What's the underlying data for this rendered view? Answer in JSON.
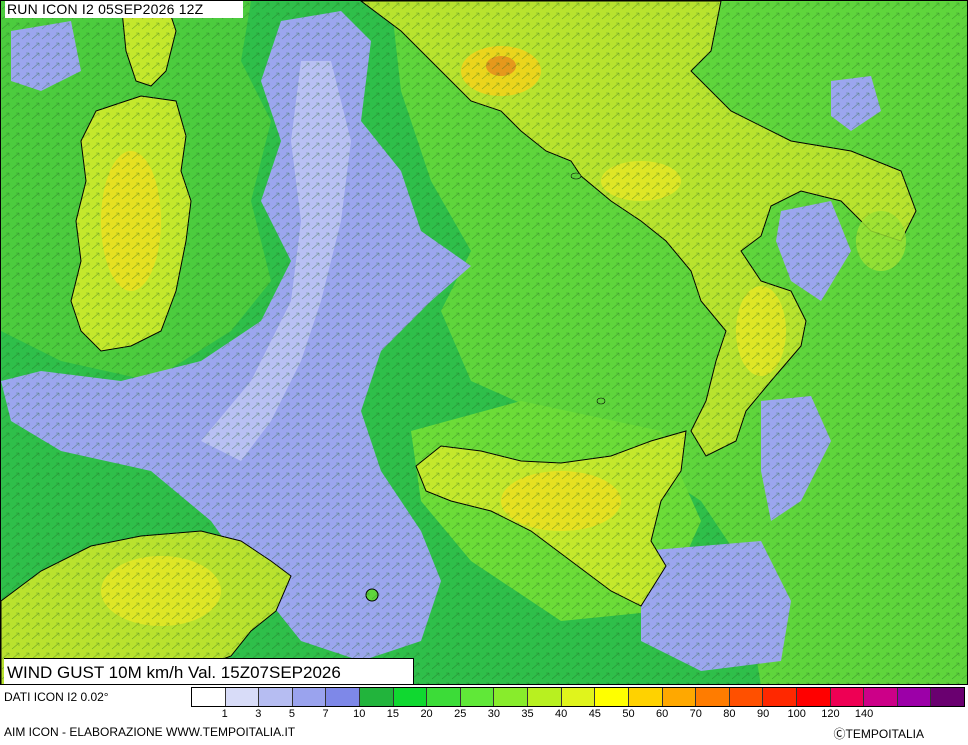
{
  "run_label": "RUN ICON I2 05SEP2026 12Z",
  "map_title": "WIND GUST 10M km/h Val. 15Z07SEP2026",
  "footer": {
    "dati": "DATI ICON I2 0.02°",
    "aim": "AIM ICON - ELABORAZIONE WWW.TEMPOITALIA.IT",
    "credit": "ⒸTEMPOITALIA"
  },
  "legend": {
    "colors": [
      "#ffffff",
      "#d8dcf8",
      "#b6bdf2",
      "#9aa3ee",
      "#7e88e8",
      "#22b43c",
      "#10d830",
      "#3cdc38",
      "#60e838",
      "#88ec2c",
      "#b8f020",
      "#e0f41c",
      "#ffff00",
      "#ffd200",
      "#ffa800",
      "#ff7c00",
      "#ff5000",
      "#ff2800",
      "#ff0000",
      "#ee0054",
      "#cc0088",
      "#9c00a8",
      "#6a0070"
    ],
    "ticks": [
      "1",
      "3",
      "5",
      "7",
      "10",
      "15",
      "20",
      "25",
      "30",
      "35",
      "40",
      "45",
      "50",
      "60",
      "70",
      "80",
      "90",
      "100",
      "120",
      "140"
    ]
  },
  "colors": {
    "sea_calm": "#9ba6ee",
    "sea_medium": "#2fbf4a",
    "sea_strong": "#6bd93a",
    "land_strong": "#c9ec2a",
    "land_peak": "#f4d31a",
    "coastline": "#000000"
  }
}
